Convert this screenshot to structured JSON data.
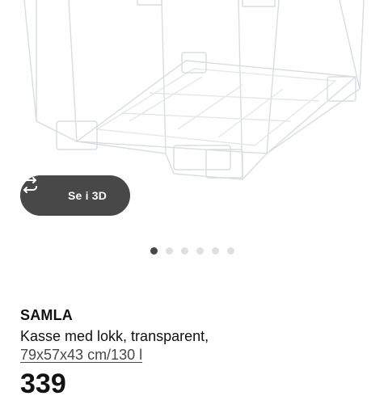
{
  "gallery": {
    "view_3d_label": "Se i 3D",
    "dot_count": 6,
    "active_index": 0
  },
  "product": {
    "name": "SAMLA",
    "description": "Kasse med lokk, transparent,",
    "size": "79x57x43 cm/130 l",
    "price": "339"
  },
  "icons": {
    "view_3d": "rotate-3d-icon"
  },
  "colors": {
    "button_bg": "#484848",
    "dot_active": "#484848",
    "dot_inactive": "#dfdfdf",
    "text": "#111111"
  }
}
